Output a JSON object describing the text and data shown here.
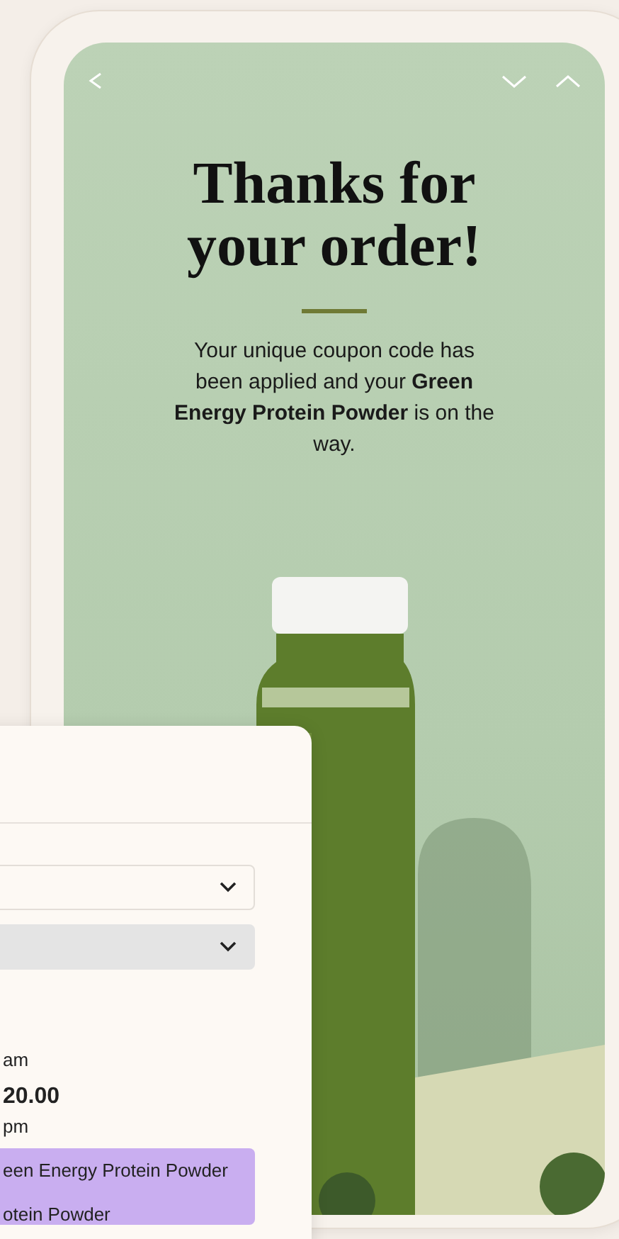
{
  "hero": {
    "title": "Thanks for your order!",
    "message": "Your unique coupon code has been applied and your **Green Energy Protein Powder** is on the way."
  },
  "card": {
    "selects": [
      {
        "disabled": false
      },
      {
        "disabled": true
      }
    ],
    "lines": [
      {
        "kind": "time",
        "text": "am"
      },
      {
        "kind": "amount",
        "text": "20.00"
      },
      {
        "kind": "time",
        "text": "pm"
      }
    ],
    "highlight": [
      "een Energy Protein Powder",
      "otein Powder"
    ]
  }
}
